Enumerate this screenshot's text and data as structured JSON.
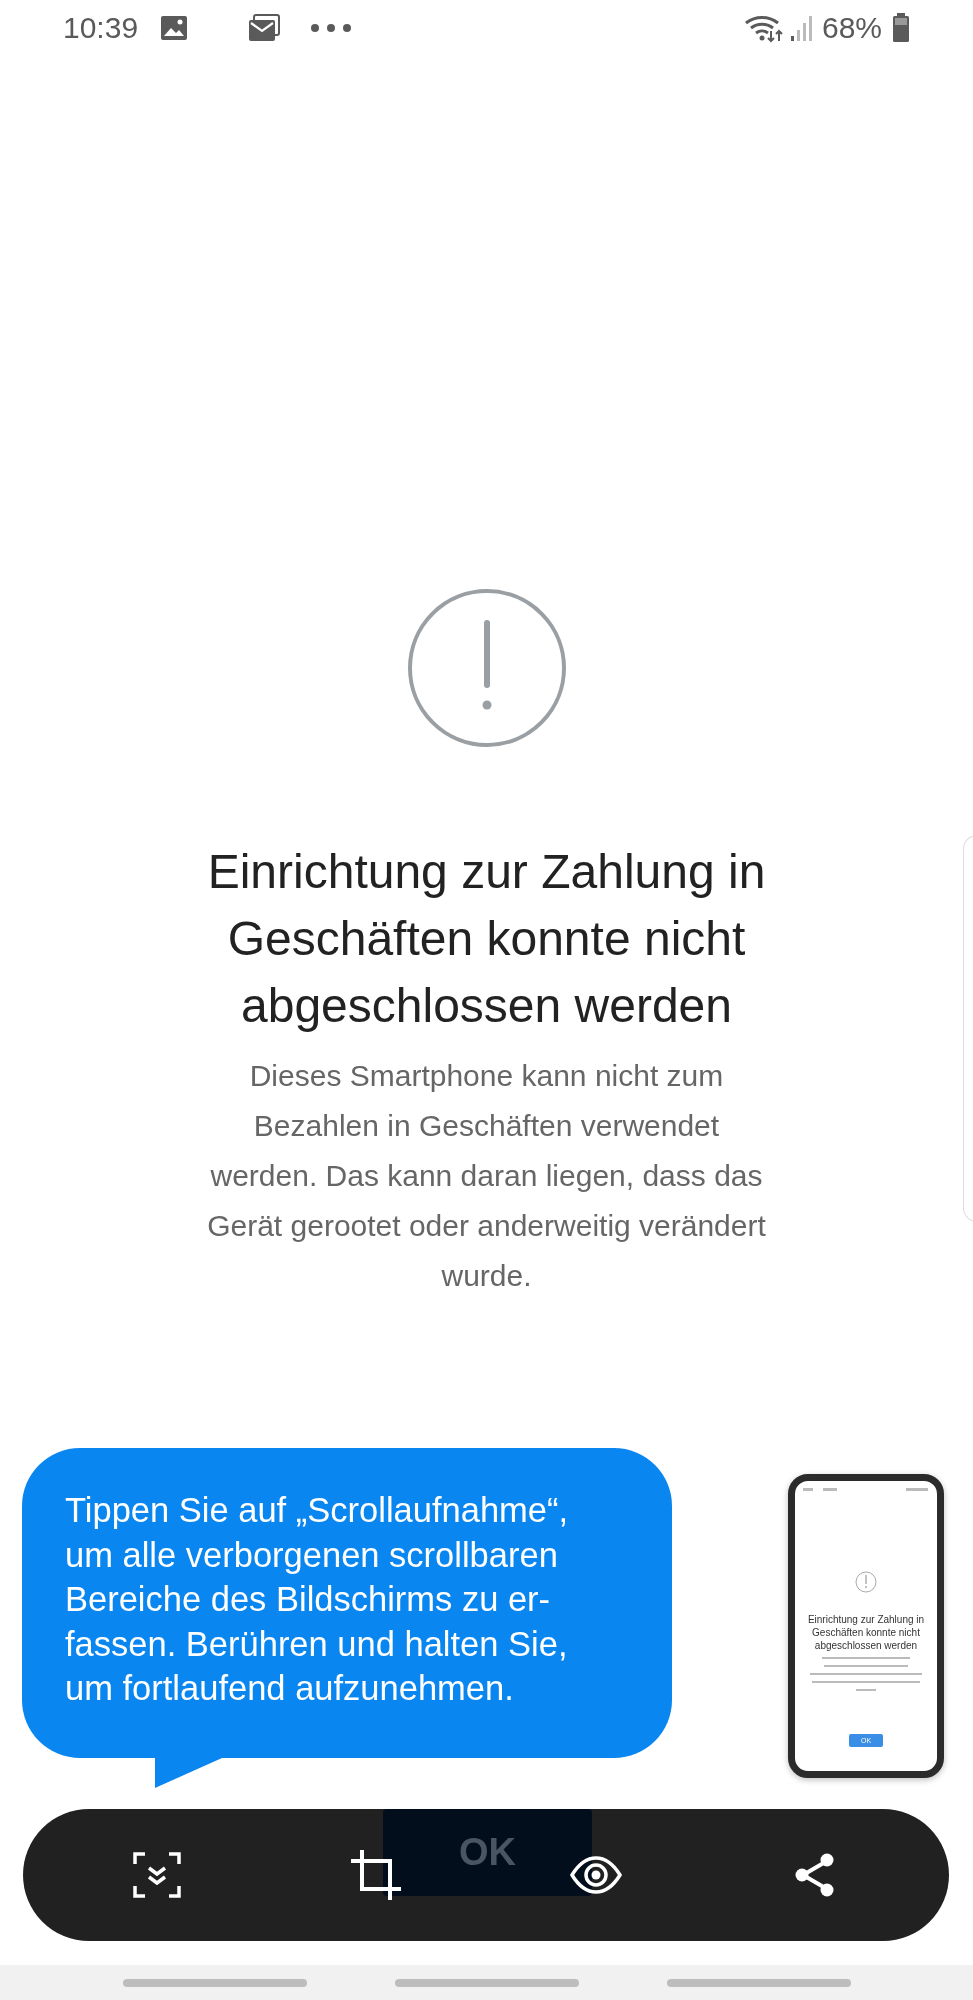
{
  "status_bar": {
    "time": "10:39",
    "battery": "68%"
  },
  "error": {
    "title": "Einrichtung zur Zahlung in\nGeschäften konnte nicht\nabgeschlossen werden",
    "message": "Dieses Smartphone kann nicht zum\nBezahlen in Geschäften verwendet\nwerden. Das kann daran liegen, dass das\nGerät gerootet oder anderweitig verändert\nwurde."
  },
  "tooltip": {
    "text": "Tippen Sie auf „Scrollaufnahme“,\num alle verborgenen scrollbaren\nBereiche des Bildschirms zu er-\nfassen. Berühren und halten Sie,\num fortlaufend aufzunehmen."
  },
  "preview": {
    "title": "Einrichtung zur Zahlung in\nGeschäften konnte nicht\nabgeschlossen werden",
    "button": "OK"
  },
  "hidden_button": {
    "label": "OK"
  },
  "toolbar": {
    "actions": [
      {
        "kind": "scroll-capture"
      },
      {
        "kind": "crop"
      },
      {
        "kind": "eye"
      },
      {
        "kind": "share"
      }
    ]
  }
}
